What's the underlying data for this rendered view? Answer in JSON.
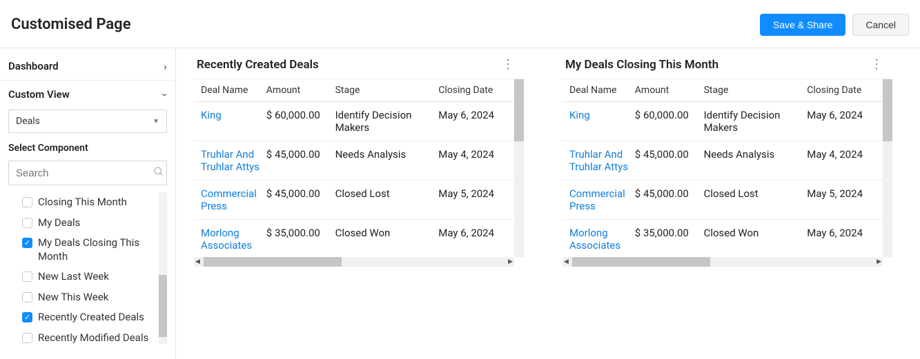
{
  "header": {
    "title": "Customised Page",
    "save_label": "Save & Share",
    "cancel_label": "Cancel"
  },
  "sidebar": {
    "dashboard_label": "Dashboard",
    "custom_view_label": "Custom View",
    "module_select": "Deals",
    "select_component_label": "Select Component",
    "search_placeholder": "Search",
    "components": [
      {
        "label": "Closing This Month",
        "checked": false
      },
      {
        "label": "My Deals",
        "checked": false
      },
      {
        "label": "My Deals Closing This Month",
        "checked": true
      },
      {
        "label": "New Last Week",
        "checked": false
      },
      {
        "label": "New This Week",
        "checked": false
      },
      {
        "label": "Recently Created Deals",
        "checked": true
      },
      {
        "label": "Recently Modified Deals",
        "checked": false
      }
    ]
  },
  "widgets": [
    {
      "title": "Recently Created Deals",
      "columns": [
        "Deal Name",
        "Amount",
        "Stage",
        "Closing Date"
      ],
      "rows": [
        {
          "name": "King",
          "amount": "$ 60,000.00",
          "stage": "Identify Decision Makers",
          "date": "May 6, 2024"
        },
        {
          "name": "Truhlar And Truhlar Attys",
          "amount": "$ 45,000.00",
          "stage": "Needs Analysis",
          "date": "May 4, 2024"
        },
        {
          "name": "Commercial Press",
          "amount": "$ 45,000.00",
          "stage": "Closed Lost",
          "date": "May 5, 2024"
        },
        {
          "name": "Morlong Associates",
          "amount": "$ 35,000.00",
          "stage": "Closed Won",
          "date": "May 6, 2024"
        }
      ]
    },
    {
      "title": "My Deals Closing This Month",
      "columns": [
        "Deal Name",
        "Amount",
        "Stage",
        "Closing Date"
      ],
      "rows": [
        {
          "name": "King",
          "amount": "$ 60,000.00",
          "stage": "Identify Decision Makers",
          "date": "May 6, 2024"
        },
        {
          "name": "Truhlar And Truhlar Attys",
          "amount": "$ 45,000.00",
          "stage": "Needs Analysis",
          "date": "May 4, 2024"
        },
        {
          "name": "Commercial Press",
          "amount": "$ 45,000.00",
          "stage": "Closed Lost",
          "date": "May 5, 2024"
        },
        {
          "name": "Morlong Associates",
          "amount": "$ 35,000.00",
          "stage": "Closed Won",
          "date": "May 6, 2024"
        }
      ]
    }
  ]
}
